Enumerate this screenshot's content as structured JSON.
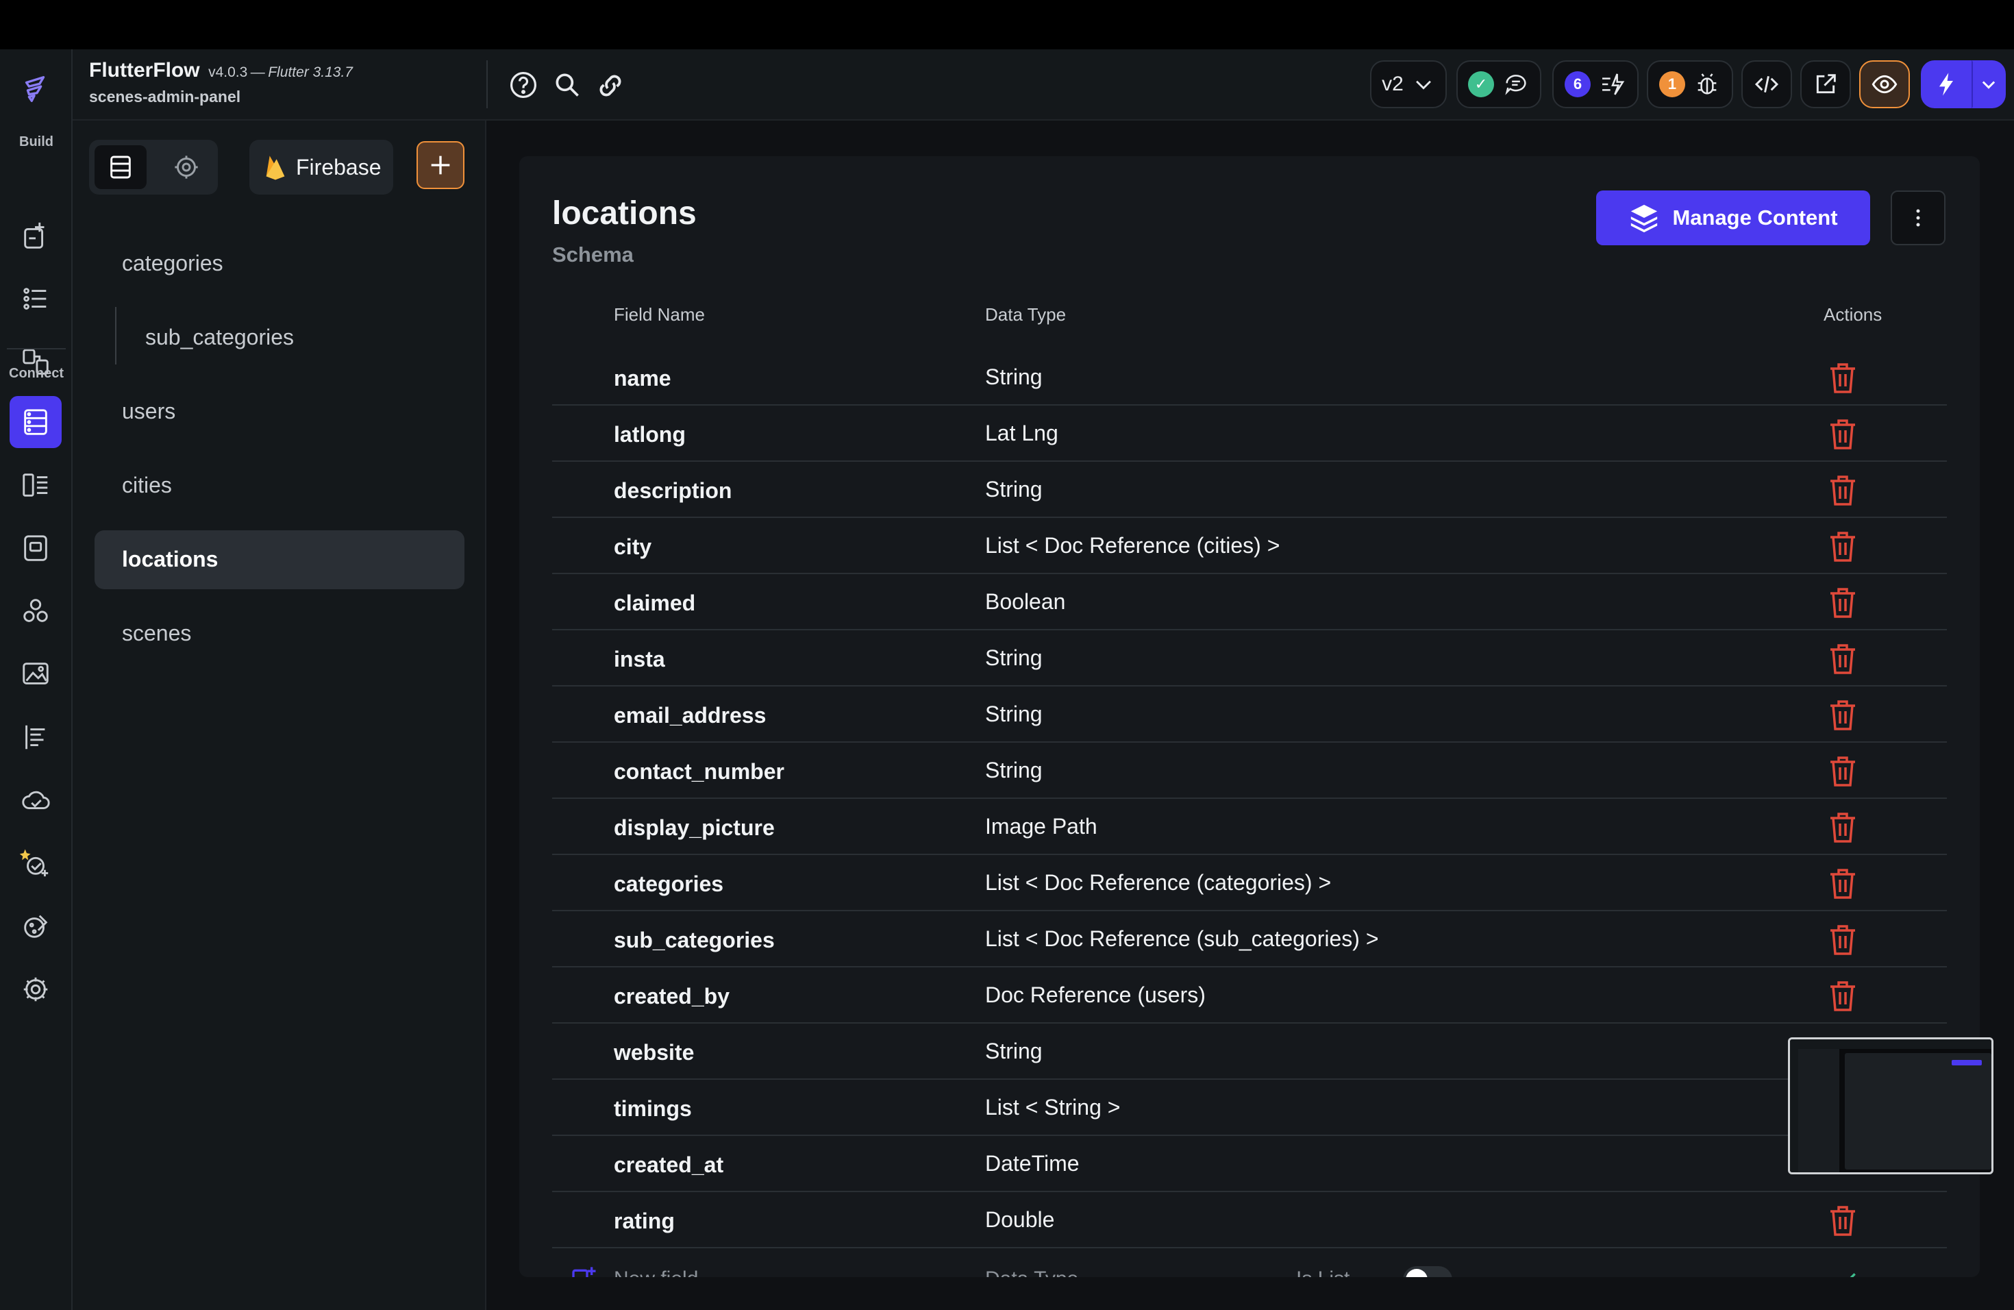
{
  "app": {
    "name": "FlutterFlow",
    "version": "v4.0.3",
    "version_sep": "—",
    "flutter_version": "Flutter 3.13.7",
    "project": "scenes-admin-panel"
  },
  "rail": {
    "build_label": "Build",
    "connect_label": "Connect"
  },
  "header": {
    "branch": "v2",
    "badge_left": "6",
    "badge_issues": "1"
  },
  "panel": {
    "firebase_label": "Firebase",
    "collections": [
      "categories",
      "sub_categories",
      "users",
      "cities",
      "locations",
      "scenes"
    ]
  },
  "collection": {
    "title": "locations",
    "subtitle": "Schema",
    "manage_label": "Manage Content",
    "col_field": "Field Name",
    "col_type": "Data Type",
    "col_actions": "Actions",
    "fields": [
      {
        "name": "name",
        "type": "String"
      },
      {
        "name": "latlong",
        "type": "Lat Lng"
      },
      {
        "name": "description",
        "type": "String"
      },
      {
        "name": "city",
        "type": "List < Doc Reference (cities) >"
      },
      {
        "name": "claimed",
        "type": "Boolean"
      },
      {
        "name": "insta",
        "type": "String"
      },
      {
        "name": "email_address",
        "type": "String"
      },
      {
        "name": "contact_number",
        "type": "String"
      },
      {
        "name": "display_picture",
        "type": "Image Path"
      },
      {
        "name": "categories",
        "type": "List < Doc Reference (categories) >"
      },
      {
        "name": "sub_categories",
        "type": "List < Doc Reference (sub_categories) >"
      },
      {
        "name": "created_by",
        "type": "Doc Reference (users)"
      },
      {
        "name": "website",
        "type": "String"
      },
      {
        "name": "timings",
        "type": "List < String >"
      },
      {
        "name": "created_at",
        "type": "DateTime"
      },
      {
        "name": "rating",
        "type": "Double"
      }
    ],
    "new_field_placeholder": "New field",
    "new_type_placeholder": "Data Type",
    "is_list_label": "Is List"
  },
  "colors": {
    "accent": "#4b39ef",
    "danger": "#e0493a",
    "orange": "#f0913a",
    "green": "#3fbf8f"
  }
}
